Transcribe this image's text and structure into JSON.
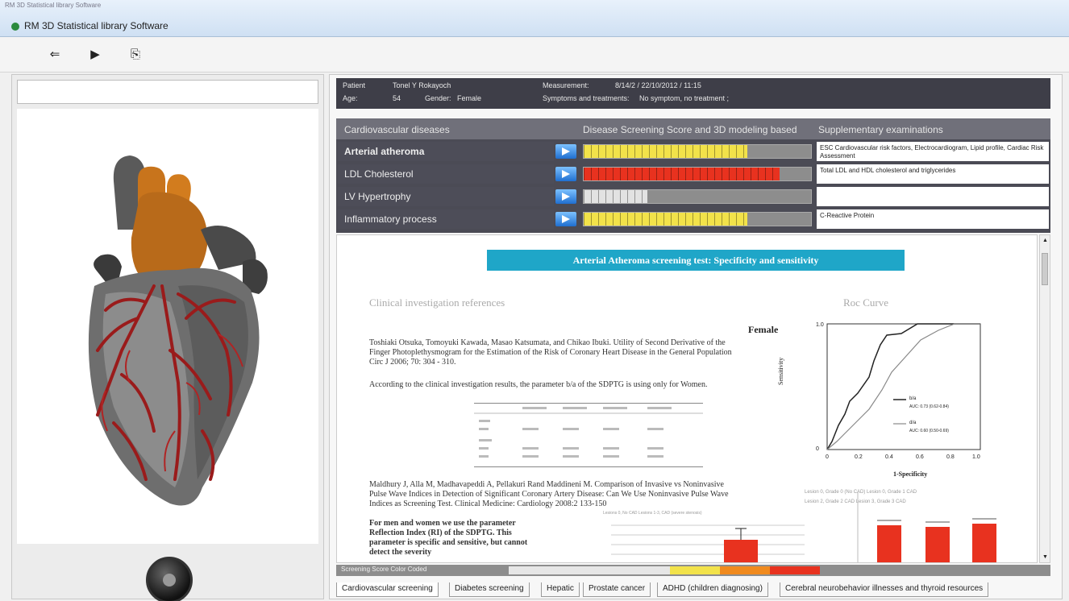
{
  "window": {
    "small_caption": "RM 3D Statistical library Software",
    "title": "RM 3D Statistical library Software"
  },
  "toolbar": {
    "back_glyph": "⇐",
    "forward_glyph": "▶",
    "export_glyph": "⎘"
  },
  "patient": {
    "patient_label": "Patient",
    "patient_name": "Tonel Y Rokayoch",
    "age_label": "Age:",
    "age_value": "54",
    "gender_label": "Gender:",
    "gender_value": "Female",
    "measurement_label": "Measurement:",
    "measurement_value": "8/14/2 / 22/10/2012 / 11:15",
    "symptoms_label": "Symptoms and treatments:",
    "symptoms_value": "No symptom, no treatment ;"
  },
  "disease_table": {
    "header_disease": "Cardiovascular diseases",
    "header_score": "Disease Screening Score and 3D modeling based",
    "header_exam": "Supplementary examinations",
    "rows": [
      {
        "name": "Arterial atheroma",
        "score": 0.72,
        "color": "#f2e24a",
        "exam": "ESC Cardiovascular risk factors, Electrocardiogram, Lipid profile, Cardiac Risk Assessment"
      },
      {
        "name": "LDL Cholesterol",
        "score": 0.86,
        "color": "#e8321f",
        "exam": "Total LDL and HDL cholesterol and triglycerides"
      },
      {
        "name": "LV Hypertrophy",
        "score": 0.28,
        "color": "#e2e2e2",
        "exam": ""
      },
      {
        "name": "Inflammatory process",
        "score": 0.72,
        "color": "#f2e24a",
        "exam": "C-Reactive Protein"
      }
    ]
  },
  "content": {
    "banner": "Arterial Atheroma screening test: Specificity and sensitivity",
    "clinical_title": "Clinical investigation references",
    "roc_title": "Roc Curve",
    "ref1": "Toshiaki Otsuka, Tomoyuki Kawada, Masao Katsumata, and Chikao Ibuki. Utility of Second Derivative of the Finger Photoplethysmogram for the Estimation of the Risk of Coronary Heart Disease in the General Population Circ J 2006; 70: 304 - 310.",
    "ref1_note": "According to the clinical investigation results, the parameter b/a of the SDPTG is using only for Women.",
    "ref2": "Maldhury J, Alla M, Madhavapeddi A, Pellakuri Rand Maddineni M. Comparison of Invasive vs Noninvasive Pulse Wave Indices in Detection of Significant Coronary Artery Disease: Can We Use Noninvasive Pulse Wave Indices as Screening Test. Clinical Medicine: Cardiology 2008:2 133-150",
    "ref2_note": "For men and women we use the parameter Reflection Index (RI) of the SDPTG. This parameter is specific and sensitive, but cannot detect the severity"
  },
  "roc_chart": {
    "label": "Female",
    "ylabel": "Sensitivity",
    "xlabel": "1-Specificity",
    "ticks": [
      "0",
      "0.2",
      "0.4",
      "0.6",
      "0.8",
      "1.0"
    ],
    "legend": [
      "b/a",
      "AUC: 0.73 (0.62-0.84)",
      "d/a",
      "AUC: 0.60 (0.50-0.69)"
    ]
  },
  "bottom_charts": {
    "legend_right_1": "Lesion 0, Grade 0 (No CAD)   Lesion 0, Grade 1 CAD",
    "legend_right_2": "Lesion 2, Grade 2 CAD   Lesion 3, Grade 3 CAD",
    "legend_left": "Lesions 0, No CAD   Lesions 1-3, CAD (severe stenosis)"
  },
  "score_strip": {
    "label": "Screening Score Color Coded"
  },
  "tabs": [
    "Cardiovascular screening",
    "Diabetes screening",
    "Hepatic",
    "Prostate cancer",
    "ADHD (children diagnosing)",
    "Cerebral neurobehavior illnesses and thyroid resources"
  ],
  "colors": {
    "accent": "#1fa6c8",
    "yellow": "#f2e24a",
    "orange": "#f08a1e",
    "red": "#e8321f",
    "dark_panel": "#3e3e48"
  }
}
